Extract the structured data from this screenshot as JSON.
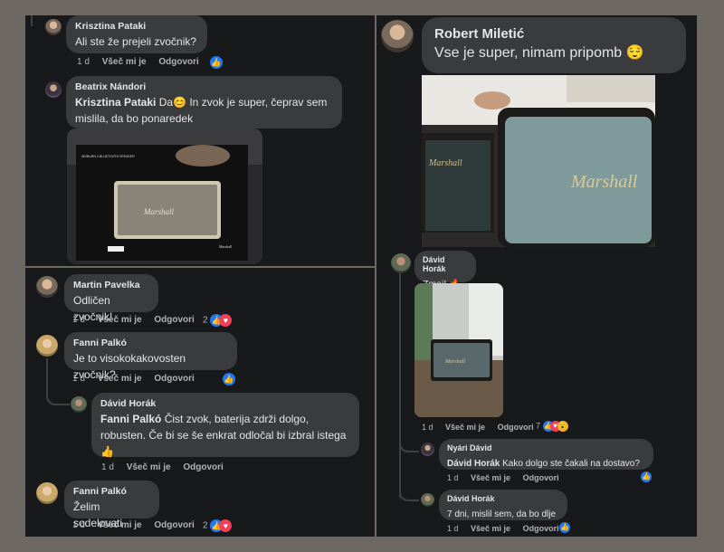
{
  "colors": {
    "background": "#6e6862",
    "panel": "#18191a",
    "bubble": "#3a3b3c",
    "text": "#e4e6eb",
    "muted": "#b0b3b8",
    "like_blue": "#2078f4",
    "heart_red": "#f33e58",
    "wow_yellow": "#f7b125"
  },
  "icons": {
    "like": "thumbs-up-icon",
    "heart": "heart-icon",
    "wow": "wow-icon",
    "fire": "fire-emoji",
    "smile": "smile-emoji",
    "relieved": "relieved-emoji",
    "thumbs": "thumbs-up-emoji"
  },
  "actions": {
    "time": "1 d",
    "like": "Všeč mi je",
    "reply": "Odgovori"
  },
  "emoji": {
    "smile": "😊",
    "relieved": "😌",
    "fire": "🔥",
    "thumb": "👍",
    "like_glyph": "👍",
    "heart_glyph": "♥",
    "wow_glyph": "😮"
  },
  "comments": {
    "c1": {
      "name": "Krisztina Pataki",
      "text": "Ali ste že prejeli zvočnik?"
    },
    "c2": {
      "name": "Beatrix Nándori",
      "tag": "Krisztina Pataki",
      "text_pre": "Da",
      "text": " In zvok je super, čeprav sem mislila, da bo ponaredek",
      "photo_brand": "Marshall",
      "box_text": "WOBURN II BLUETOOTH SPEAKER"
    },
    "c3": {
      "name": "Martin Pavelka",
      "text": "Odličen zvočnik!",
      "reactions": "2"
    },
    "c4": {
      "name": "Fanni Palkó",
      "text": "Je to visokokakovosten zvočnik?"
    },
    "c5": {
      "name": "Dávid Horák",
      "tag": "Fanni Palkó",
      "text": " Čist zvok, baterija zdrži dolgo, robusten. Če bi se še enkrat odločal bi izbral istega"
    },
    "c6": {
      "name": "Fanni Palkó",
      "text": "Želim sodelovati",
      "reactions": "2"
    },
    "c7": {
      "name": "Robert Miletić",
      "text": "Vse je super, nimam pripomb",
      "photo_brand": "Marshall"
    },
    "c8": {
      "name": "Dávid Horák",
      "text": "Zmaj!",
      "reactions": "7",
      "photo_brand": "Marshall"
    },
    "c9": {
      "name": "Nyári Dávid",
      "tag": "Dávid Horák",
      "text": " Kako dolgo ste čakali na dostavo?"
    },
    "c10": {
      "name": "Dávid Horák",
      "text": "7 dni, mislil sem, da bo dlje"
    }
  }
}
